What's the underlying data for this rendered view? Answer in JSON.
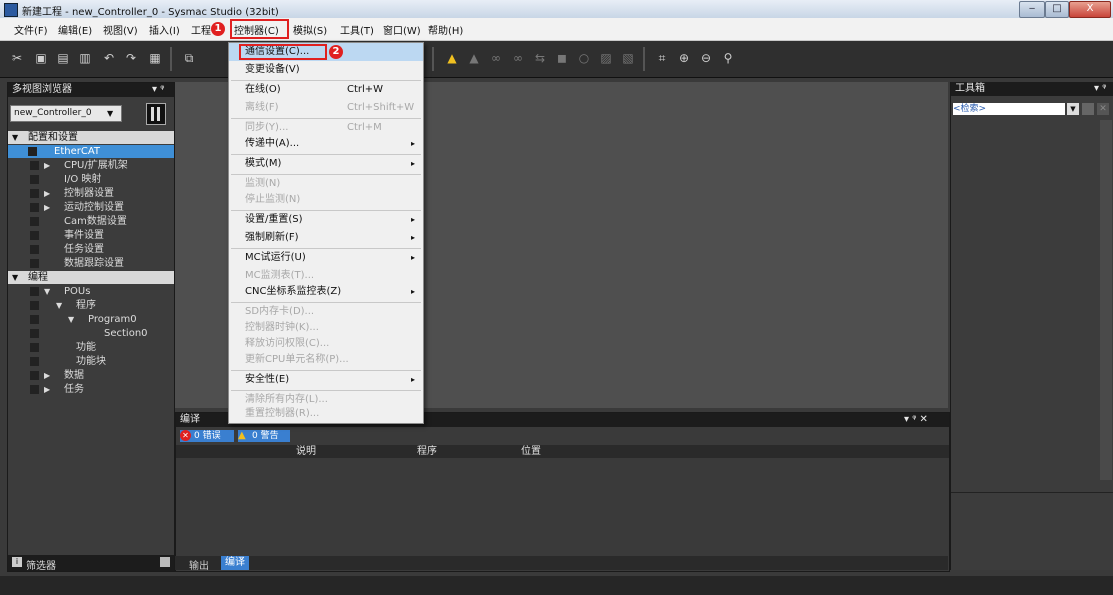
{
  "window": {
    "title": "新建工程 - new_Controller_0 - Sysmac Studio (32bit)",
    "min": "‒",
    "max": "□",
    "close": "X"
  },
  "menu": {
    "items": [
      "文件(F)",
      "编辑(E)",
      "视图(V)",
      "插入(I)",
      "工程",
      "控制器(C)",
      "模拟(S)",
      "工具(T)",
      "窗口(W)",
      "帮助(H)"
    ],
    "badge1": "1",
    "badge2": "2"
  },
  "left": {
    "title": "多视图浏览器",
    "pin": "▾ ᵠ",
    "controller": "new_Controller_0",
    "tree": [
      "配置和设置",
      "EtherCAT",
      "CPU/扩展机架",
      "I/O 映射",
      "控制器设置",
      "运动控制设置",
      "Cam数据设置",
      "事件设置",
      "任务设置",
      "数据跟踪设置",
      "编程",
      "POUs",
      "程序",
      "Program0",
      "Section0",
      "功能",
      "功能块",
      "数据",
      "任务"
    ],
    "filter": "筛选器"
  },
  "dropdown": {
    "items": [
      {
        "label": "通信设置(C)...",
        "shortcut": "",
        "arrow": "",
        "disabled": false
      },
      {
        "label": "变更设备(V)",
        "shortcut": "",
        "arrow": "",
        "disabled": false
      },
      {
        "label": "在线(O)",
        "shortcut": "Ctrl+W",
        "arrow": "",
        "disabled": false
      },
      {
        "label": "离线(F)",
        "shortcut": "Ctrl+Shift+W",
        "arrow": "",
        "disabled": true
      },
      {
        "label": "同步(Y)...",
        "shortcut": "Ctrl+M",
        "arrow": "",
        "disabled": true
      },
      {
        "label": "传递中(A)...",
        "shortcut": "",
        "arrow": "▸",
        "disabled": false
      },
      {
        "label": "模式(M)",
        "shortcut": "",
        "arrow": "▸",
        "disabled": false
      },
      {
        "label": "监测(N)",
        "shortcut": "",
        "arrow": "",
        "disabled": true
      },
      {
        "label": "停止监测(N)",
        "shortcut": "",
        "arrow": "",
        "disabled": true
      },
      {
        "label": "设置/重置(S)",
        "shortcut": "",
        "arrow": "▸",
        "disabled": false
      },
      {
        "label": "强制刷新(F)",
        "shortcut": "",
        "arrow": "▸",
        "disabled": false
      },
      {
        "label": "MC试运行(U)",
        "shortcut": "",
        "arrow": "▸",
        "disabled": false
      },
      {
        "label": "MC监测表(T)...",
        "shortcut": "",
        "arrow": "",
        "disabled": true
      },
      {
        "label": "CNC坐标系监控表(Z)",
        "shortcut": "",
        "arrow": "▸",
        "disabled": false
      },
      {
        "label": "SD内存卡(D)...",
        "shortcut": "",
        "arrow": "",
        "disabled": true
      },
      {
        "label": "控制器时钟(K)...",
        "shortcut": "",
        "arrow": "",
        "disabled": true
      },
      {
        "label": "释放访问权限(C)...",
        "shortcut": "",
        "arrow": "",
        "disabled": true
      },
      {
        "label": "更新CPU单元名称(P)...",
        "shortcut": "",
        "arrow": "",
        "disabled": true
      },
      {
        "label": "安全性(E)",
        "shortcut": "",
        "arrow": "▸",
        "disabled": false
      },
      {
        "label": "清除所有内存(L)...",
        "shortcut": "",
        "arrow": "",
        "disabled": true
      },
      {
        "label": "重置控制器(R)...",
        "shortcut": "",
        "arrow": "",
        "disabled": true
      }
    ]
  },
  "output": {
    "title": "编译",
    "pin": "▾ ᵠ ✕",
    "errors": "0 错误",
    "warnings": "0 警告",
    "columns": [
      "说明",
      "程序",
      "位置"
    ]
  },
  "bottom_tabs": [
    "输出",
    "编译"
  ],
  "right": {
    "title": "工具箱",
    "pin": "▾ ᵠ",
    "search_placeholder": "<检索>"
  },
  "colors": {
    "highlight": "#3f8fd6",
    "annotation": "#e02020"
  }
}
